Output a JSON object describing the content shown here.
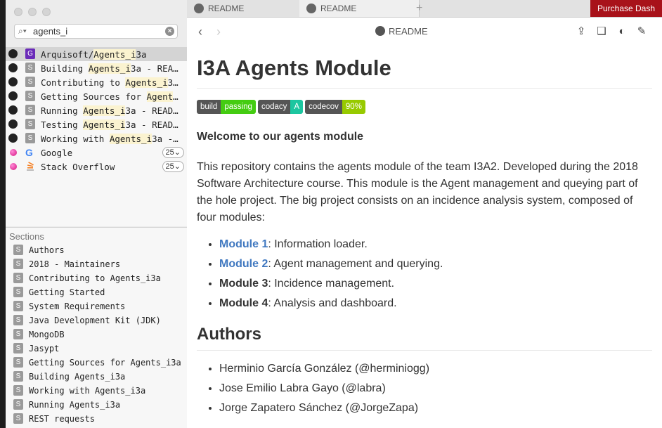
{
  "sidebar": {
    "search": {
      "value": "agents_i",
      "placeholder": ""
    },
    "results": [
      {
        "pre": "Arquisoft/",
        "hl": "Agents_i",
        "post": "3a",
        "icon": "github",
        "doctype": "G",
        "selected": true
      },
      {
        "pre": "Building ",
        "hl": "Agents_i",
        "post": "3a - REA…",
        "icon": "github",
        "doctype": "S"
      },
      {
        "pre": "Contributing to ",
        "hl": "Agents_i",
        "post": "3…",
        "icon": "github",
        "doctype": "S"
      },
      {
        "pre": "Getting Sources for ",
        "hl": "Agent",
        "post": "…",
        "icon": "github",
        "doctype": "S"
      },
      {
        "pre": "Running ",
        "hl": "Agents_i",
        "post": "3a - READ…",
        "icon": "github",
        "doctype": "S"
      },
      {
        "pre": "Testing ",
        "hl": "Agents_i",
        "post": "3a - READ…",
        "icon": "github",
        "doctype": "S"
      },
      {
        "pre": "Working with ",
        "hl": "Agents_i",
        "post": "3a -…",
        "icon": "github",
        "doctype": "S"
      }
    ],
    "google": {
      "label": "Google",
      "badge": "25"
    },
    "stack": {
      "label": "Stack Overflow",
      "badge": "25"
    },
    "sections_title": "Sections",
    "sections": [
      "Authors",
      "2018 - Maintainers",
      "Contributing to Agents_i3a",
      "Getting Started",
      "System Requirements",
      "Java Development Kit (JDK)",
      "MongoDB",
      "Jasypt",
      "Getting Sources for Agents_i3a",
      "Building Agents_i3a",
      "Working with Agents_i3a",
      "Running Agents_i3a",
      "REST requests"
    ]
  },
  "tabs": {
    "tab1": "README",
    "tab2": "README",
    "add": "+",
    "purchase": "Purchase Dash"
  },
  "toolbar": {
    "title": "README"
  },
  "doc": {
    "h1": "I3A Agents Module",
    "badges": [
      {
        "left": "build",
        "right": "passing",
        "color": "#4c1"
      },
      {
        "left": "codacy",
        "right": "A",
        "color": "#1cc6a0"
      },
      {
        "left": "codecov",
        "right": "90%",
        "color": "#97ca00"
      }
    ],
    "welcome": "Welcome to our agents module",
    "paragraph": "This repository contains the agents module of the team I3A2. Developed during the 2018 Software Architecture course. This module is the Agent management and queying part of the hole project. The big project consists on an incidence analysis system, composed of four modules:",
    "modules": [
      {
        "name": "Module 1",
        "desc": ": Information loader.",
        "link": true
      },
      {
        "name": "Module 2",
        "desc": ": Agent management and querying.",
        "link": true
      },
      {
        "name": "Module 3",
        "desc": ": Incidence management.",
        "link": false
      },
      {
        "name": "Module 4",
        "desc": ": Analysis and dashboard.",
        "link": false
      }
    ],
    "h2": "Authors",
    "authors": [
      "Herminio García González (@herminiogg)",
      "Jose Emilio Labra Gayo (@labra)",
      "Jorge Zapatero Sánchez (@JorgeZapa)"
    ]
  }
}
